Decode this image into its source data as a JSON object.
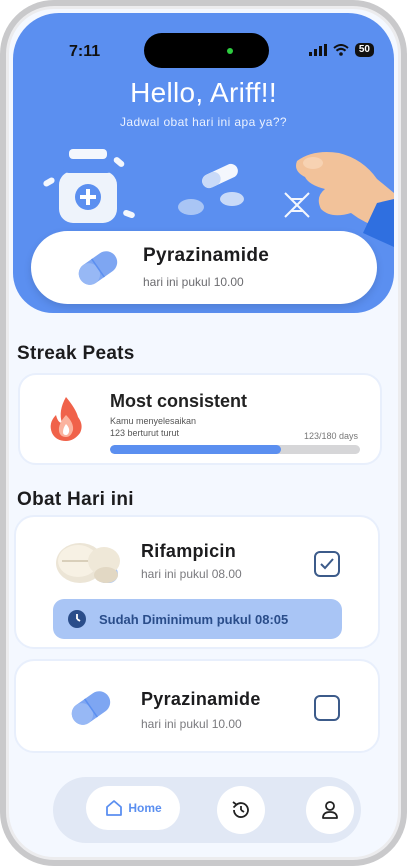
{
  "status_bar": {
    "time": "7:11",
    "battery": "50"
  },
  "header": {
    "greeting": "Hello, Ariff!!",
    "subtitle": "Jadwal obat hari ini apa ya??"
  },
  "next_medicine": {
    "name": "Pyrazinamide",
    "time": "hari ini pukul 10.00"
  },
  "streak": {
    "section_title": "Streak Peats",
    "title": "Most consistent",
    "line1": "Kamu menyelesaikan",
    "line2": "123 berturut turut",
    "count_label": "123/180 days",
    "progress": 0.683
  },
  "today": {
    "section_title": "Obat Hari ini",
    "items": [
      {
        "name": "Rifampicin",
        "time": "hari ini pukul 08.00",
        "checked": true,
        "status": "Sudah Diminimum pukul 08:05"
      },
      {
        "name": "Pyrazinamide",
        "time": "hari ini pukul 10.00",
        "checked": false
      }
    ]
  },
  "nav": {
    "home_label": "Home"
  },
  "colors": {
    "primary": "#5b8ff0",
    "background": "#f4f8ff",
    "progress_track": "#d6d6d8",
    "banner": "#a9c5f5"
  },
  "icons": [
    "pill-icon",
    "fire-icon",
    "check-icon",
    "clock-icon",
    "home-icon",
    "history-icon",
    "profile-icon",
    "signal-icon",
    "wifi-icon"
  ]
}
